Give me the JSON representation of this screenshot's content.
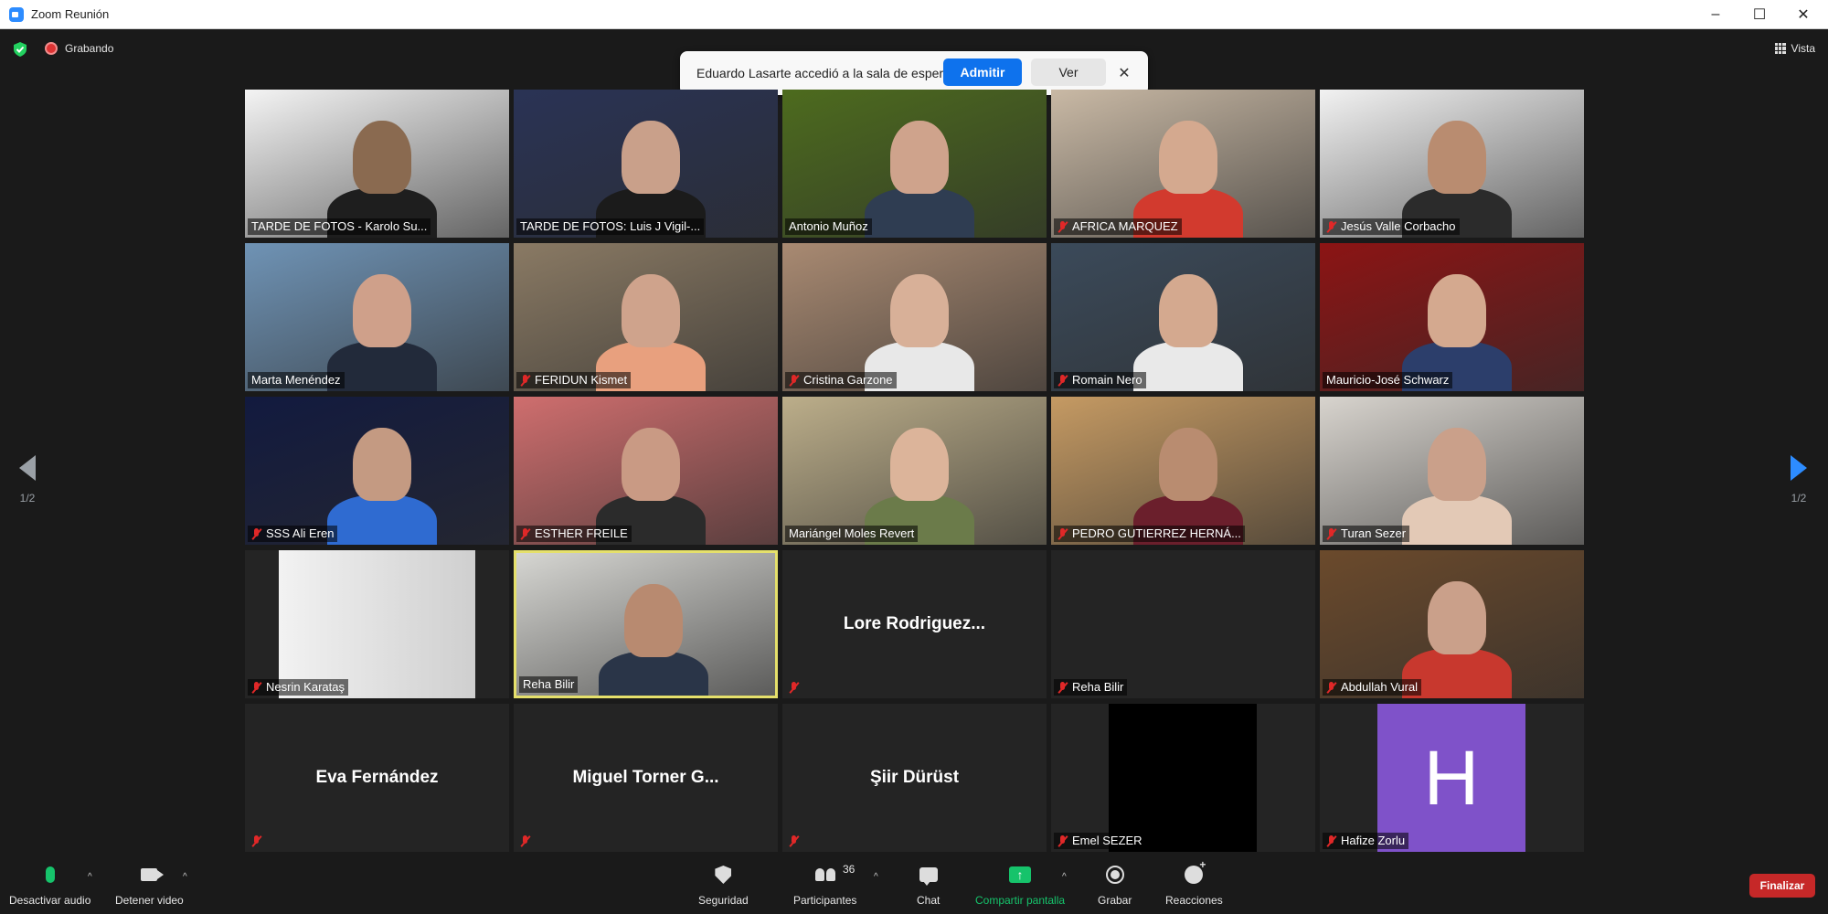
{
  "window": {
    "title": "Zoom Reunión"
  },
  "topbar": {
    "recording_label": "Grabando",
    "view_label": "Vista"
  },
  "notification": {
    "message": "Eduardo Lasarte accedió a la sala de espera",
    "admit_label": "Admitir",
    "view_label": "Ver",
    "close_glyph": "✕"
  },
  "pagination": {
    "current_left": "1/2",
    "current_right": "1/2"
  },
  "tiles": [
    {
      "name": "TARDE DE FOTOS - Karolo Su...",
      "muted": false,
      "type": "video",
      "bg": "#f4f4f4",
      "skin": "#8a6a50",
      "shirt": "#1e1e1e"
    },
    {
      "name": "TARDE DE FOTOS: Luis J Vigil-...",
      "muted": false,
      "type": "video",
      "bg": "#2a3355",
      "skin": "#c9a08a",
      "shirt": "#1b1b1b"
    },
    {
      "name": "Antonio Muñoz",
      "muted": false,
      "type": "video",
      "bg": "#4d6b1e",
      "skin": "#cfa38c",
      "shirt": "#2f3d52"
    },
    {
      "name": "AFRICA MARQUEZ",
      "muted": true,
      "type": "video",
      "bg": "#c9b9a5",
      "skin": "#d4a98f",
      "shirt": "#d23a2e"
    },
    {
      "name": "Jesús Valle Corbacho",
      "muted": true,
      "type": "video",
      "bg": "#f2f2f2",
      "skin": "#b98c70",
      "shirt": "#2b2b2b"
    },
    {
      "name": "Marta Menéndez",
      "muted": false,
      "type": "video",
      "bg": "#6f93b5",
      "skin": "#cfa08a",
      "shirt": "#222a3a"
    },
    {
      "name": "FERIDUN Kismet",
      "muted": true,
      "type": "video",
      "bg": "#8a7a64",
      "skin": "#cfa38c",
      "shirt": "#e8a07e"
    },
    {
      "name": "Cristina Garzone",
      "muted": true,
      "type": "video",
      "bg": "#a98a72",
      "skin": "#d8b098",
      "shirt": "#e8e8e8"
    },
    {
      "name": "Romain Nero",
      "muted": true,
      "type": "video",
      "bg": "#3b4a5a",
      "skin": "#d4a98f",
      "shirt": "#e9e9e9"
    },
    {
      "name": "Mauricio-José Schwarz",
      "muted": false,
      "type": "video",
      "bg": "#8c1414",
      "skin": "#d4a98f",
      "shirt": "#2c3e6b"
    },
    {
      "name": "SSS Ali Eren",
      "muted": true,
      "type": "video",
      "bg": "#121a3f",
      "skin": "#c49a82",
      "shirt": "#2f6bd1"
    },
    {
      "name": "ESTHER FREILE",
      "muted": true,
      "type": "video",
      "bg": "#cf6e6e",
      "skin": "#c99a84",
      "shirt": "#2b2b2b"
    },
    {
      "name": "Mariángel Moles Revert",
      "muted": false,
      "type": "video",
      "bg": "#bcae8a",
      "skin": "#dcb49a",
      "shirt": "#6b7b4a"
    },
    {
      "name": "PEDRO GUTIERREZ HERNÁ...",
      "muted": true,
      "type": "video",
      "bg": "#c59a63",
      "skin": "#b98c70",
      "shirt": "#6b1f2c"
    },
    {
      "name": "Turan Sezer",
      "muted": true,
      "type": "video",
      "bg": "#d8d4ce",
      "skin": "#caa08a",
      "shirt": "#e3c9b6"
    },
    {
      "name": "Nesrin Karataş",
      "muted": true,
      "type": "video_small",
      "bg": "#e6e6e6"
    },
    {
      "name": "Reha Bilir",
      "muted": false,
      "type": "video",
      "active": true,
      "bg": "#d6d6d2",
      "skin": "#b88a70",
      "shirt": "#2a3548"
    },
    {
      "name": "Lore Rodriguez...",
      "muted": true,
      "type": "name",
      "show_tag_name": false
    },
    {
      "name": "Reha Bilir",
      "muted": true,
      "type": "blank"
    },
    {
      "name": "Abdullah Vural",
      "muted": true,
      "type": "video",
      "bg": "#6b4a2c",
      "skin": "#caa08a",
      "shirt": "#c8382e"
    },
    {
      "name": "Eva Fernández",
      "muted": true,
      "type": "name",
      "show_tag_name": false
    },
    {
      "name": "Miguel Torner G...",
      "muted": true,
      "type": "name",
      "show_tag_name": false
    },
    {
      "name": "Şiir Dürüst",
      "muted": true,
      "type": "name",
      "show_tag_name": false
    },
    {
      "name": "Emel SEZER",
      "muted": true,
      "type": "black"
    },
    {
      "name": "Hafize Zorlu",
      "muted": true,
      "type": "avatar",
      "initial": "H"
    }
  ],
  "toolbar": {
    "mute_label": "Desactivar audio",
    "video_label": "Detener video",
    "security_label": "Seguridad",
    "participants_label": "Participantes",
    "participants_count": "36",
    "chat_label": "Chat",
    "share_label": "Compartir pantalla",
    "share_glyph": "↑",
    "record_label": "Grabar",
    "reactions_label": "Reacciones",
    "end_label": "Finalizar",
    "caret_glyph": "^"
  },
  "colors": {
    "accent": "#0e72ed",
    "active_speaker": "#e5e06b",
    "end": "#c62828",
    "share": "#16c36b",
    "avatar": "#7f52c9"
  }
}
